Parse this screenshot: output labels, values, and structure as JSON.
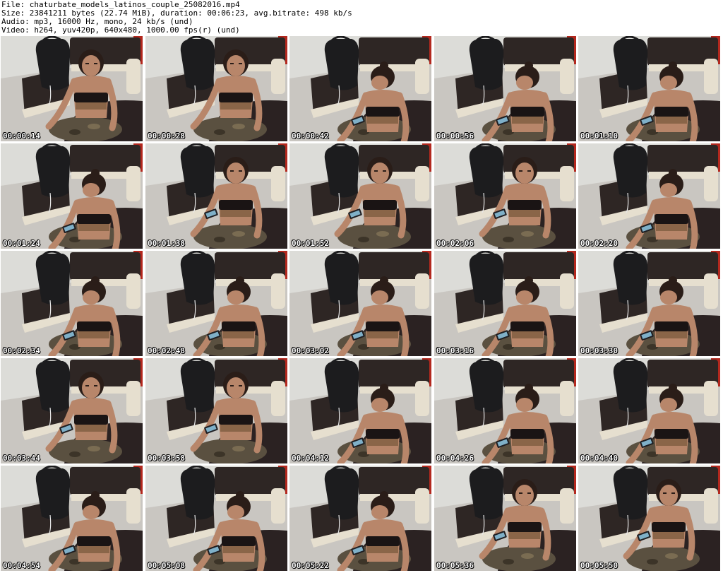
{
  "info": {
    "file": "File: chaturbate_models_latinos_couple_25082016.mp4",
    "size": "Size: 23841211 bytes (22.74 MiB), duration: 00:06:23, avg.bitrate: 498 kb/s",
    "audio": "Audio: mp3, 16000 Hz, mono, 24 kb/s (und)",
    "video": "Video: h264, yuv420p, 640x480, 1000.00 fps(r) (und)"
  },
  "thumbnails": [
    {
      "time": "00:00:14",
      "pose": "looking-up",
      "phone": false
    },
    {
      "time": "00:00:28",
      "pose": "looking-up",
      "phone": false
    },
    {
      "time": "00:00:42",
      "pose": "bent-down",
      "phone": true
    },
    {
      "time": "00:00:56",
      "pose": "head-down",
      "phone": true
    },
    {
      "time": "00:01:10",
      "pose": "head-down",
      "phone": true
    },
    {
      "time": "00:01:24",
      "pose": "head-down",
      "phone": true
    },
    {
      "time": "00:01:38",
      "pose": "looking-up",
      "phone": true
    },
    {
      "time": "00:01:52",
      "pose": "looking-up",
      "phone": true
    },
    {
      "time": "00:02:06",
      "pose": "looking-up",
      "phone": true
    },
    {
      "time": "00:02:20",
      "pose": "head-down",
      "phone": true
    },
    {
      "time": "00:02:34",
      "pose": "head-down",
      "phone": true
    },
    {
      "time": "00:02:48",
      "pose": "head-down",
      "phone": true
    },
    {
      "time": "00:03:02",
      "pose": "head-down",
      "phone": true
    },
    {
      "time": "00:03:16",
      "pose": "head-down",
      "phone": true
    },
    {
      "time": "00:03:30",
      "pose": "head-down",
      "phone": true
    },
    {
      "time": "00:03:44",
      "pose": "looking-up",
      "phone": true
    },
    {
      "time": "00:03:58",
      "pose": "looking-up",
      "phone": true
    },
    {
      "time": "00:04:12",
      "pose": "head-down",
      "phone": true
    },
    {
      "time": "00:04:26",
      "pose": "head-down",
      "phone": true
    },
    {
      "time": "00:04:40",
      "pose": "head-down",
      "phone": true
    },
    {
      "time": "00:04:54",
      "pose": "head-down",
      "phone": true
    },
    {
      "time": "00:05:08",
      "pose": "head-down",
      "phone": true
    },
    {
      "time": "00:05:22",
      "pose": "head-down",
      "phone": true
    },
    {
      "time": "00:05:36",
      "pose": "looking-up",
      "phone": true
    },
    {
      "time": "00:05:50",
      "pose": "looking-up",
      "phone": true
    }
  ],
  "colors": {
    "floor": "#c9c6c1",
    "wall": "#dcdcd8",
    "sofa": "#2e2624",
    "sofa_trim": "#e6dfcf",
    "bag": "#1c1c1e",
    "skin": "#b8866a",
    "hair": "#2a1d18",
    "top": "#1a1414",
    "pants": "#5a5040",
    "phone": "#1e1e22",
    "screen": "#7fb0c8",
    "red_accent": "#b3281e",
    "seat": "#2b2222"
  }
}
